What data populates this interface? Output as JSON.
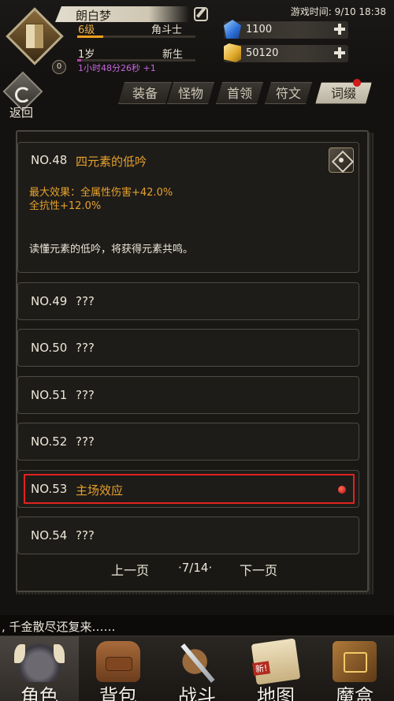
{
  "header": {
    "player_name": "朗白梦",
    "level": "6级",
    "class_name": "角斗士",
    "level_progress": 0.22,
    "age": "1岁",
    "age_stage": "新生",
    "age_progress": 0.03,
    "age_timer": "1小时48分26秒 +1",
    "avatar_badge": "0",
    "game_time": "游戏时间: 9/10 18:38"
  },
  "currencies": {
    "gems": "1100",
    "gold": "50120"
  },
  "back": {
    "label": "返回"
  },
  "tabs": [
    {
      "label": "装备",
      "active": false
    },
    {
      "label": "怪物",
      "active": false
    },
    {
      "label": "首领",
      "active": false
    },
    {
      "label": "符文",
      "active": false
    },
    {
      "label": "词缀",
      "active": true
    }
  ],
  "entries": {
    "e48": {
      "num": "NO.48",
      "title": "四元素的低吟",
      "effect_1": "最大效果：全属性伤害+42.0%",
      "effect_2": "全抗性+12.0%",
      "description": "读懂元素的低吟，将获得元素共鸣。"
    },
    "e49": {
      "num": "NO.49",
      "title": "???"
    },
    "e50": {
      "num": "NO.50",
      "title": "???"
    },
    "e51": {
      "num": "NO.51",
      "title": "???"
    },
    "e52": {
      "num": "NO.52",
      "title": "???"
    },
    "e53": {
      "num": "NO.53",
      "title": "主场效应"
    },
    "e54": {
      "num": "NO.54",
      "title": "???"
    }
  },
  "pagination": {
    "prev_label": "上一页",
    "page": "·7/14·",
    "next_label": "下一页"
  },
  "ticker": ", 千金散尽还复来……",
  "bottom_nav": [
    {
      "label": "角色",
      "icon": "helmet-icon",
      "active": true
    },
    {
      "label": "背包",
      "icon": "backpack-icon",
      "active": false
    },
    {
      "label": "战斗",
      "icon": "sword-shield-icon",
      "active": false
    },
    {
      "label": "地图",
      "icon": "map-scroll-icon",
      "active": false
    },
    {
      "label": "魔盒",
      "icon": "magic-box-icon",
      "active": false
    }
  ],
  "colors": {
    "accent_orange": "#e6a12c",
    "level_bar": "#f0a020",
    "age_bar": "#c03db0",
    "highlight_red": "#e0231f"
  }
}
